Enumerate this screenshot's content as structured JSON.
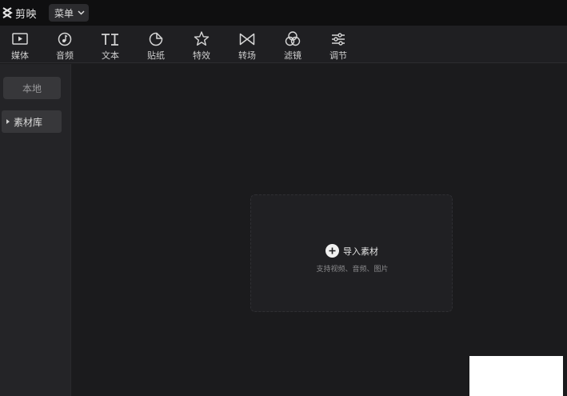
{
  "app": {
    "name": "剪映"
  },
  "titlebar": {
    "menu_label": "菜单"
  },
  "toolbar": {
    "items": [
      {
        "label": "媒体",
        "icon": "media-icon"
      },
      {
        "label": "音频",
        "icon": "audio-icon"
      },
      {
        "label": "文本",
        "icon": "text-icon"
      },
      {
        "label": "贴纸",
        "icon": "sticker-icon"
      },
      {
        "label": "特效",
        "icon": "effects-icon"
      },
      {
        "label": "转场",
        "icon": "transition-icon"
      },
      {
        "label": "滤镜",
        "icon": "filter-icon"
      },
      {
        "label": "调节",
        "icon": "adjust-icon"
      }
    ]
  },
  "sidebar": {
    "local_label": "本地",
    "library_label": "素材库"
  },
  "import": {
    "label": "导入素材",
    "hint": "支持视频、音频、图片"
  }
}
